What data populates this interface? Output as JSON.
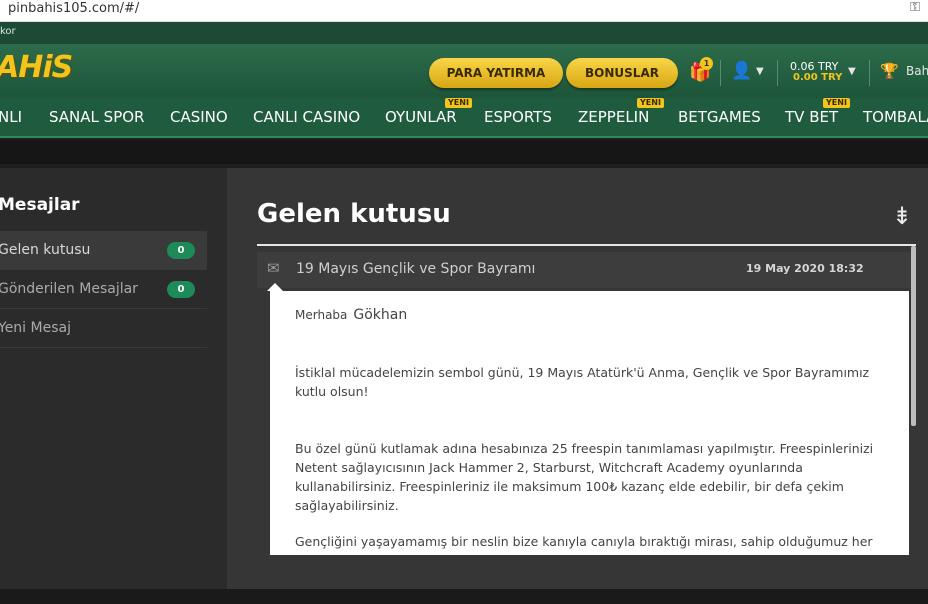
{
  "browser": {
    "url": "pinbahis105.com/#/"
  },
  "strip": {
    "text": "kor"
  },
  "header": {
    "logo": "AHiS",
    "deposit_label": "PARA YATIRMA",
    "bonus_label": "BONUSLAR",
    "gift_count": "1",
    "balance_main": "0.06 TRY",
    "balance_bonus": "0.00 TRY",
    "bets_label": "Bah"
  },
  "nav": {
    "items": [
      "NLI",
      "SANAL SPOR",
      "CASINO",
      "CANLI CASINO",
      "OYUNLAR",
      "ESPORTS",
      "ZEPPELIN",
      "BETGAMES",
      "TV BET",
      "TOMBALA"
    ],
    "new_label": "YENI"
  },
  "sidebar": {
    "title": "Mesajlar",
    "items": [
      {
        "label": "Gelen kutusu",
        "count": "0"
      },
      {
        "label": "Gönderilen Mesajlar",
        "count": "0"
      },
      {
        "label": "Yeni Mesaj"
      }
    ]
  },
  "main": {
    "title": "Gelen kutusu",
    "message": {
      "subject": "19 Mayıs Gençlik ve Spor Bayramı",
      "date": "19 May 2020 18:32",
      "greeting": "Merhaba",
      "name": "Gökhan",
      "paragraphs": [
        "İstiklal mücadelemizin sembol günü, 19 Mayıs Atatürk'ü Anma, Gençlik ve Spor Bayramımız kutlu olsun!",
        "Bu özel günü kutlamak adına hesabınıza 25 freespin tanımlaması yapılmıştır. Freespinlerinizi Netent sağlayıcısının Jack Hammer 2, Starburst, Witchcraft Academy oyunlarında kullanabilirsiniz. Freespinleriniz ile maksimum 100₺ kazanç elde edebilir, bir defa çekim sağlayabilirsiniz.",
        "Gençliğini yaşayamamış bir neslin bize kanıyla canıyla bıraktığı mirası, sahip olduğumuz her şeyin"
      ]
    }
  },
  "colors": {
    "brand_green": "#1f5b3d",
    "gold": "#f2c41e",
    "badge_green": "#1e8a57"
  }
}
